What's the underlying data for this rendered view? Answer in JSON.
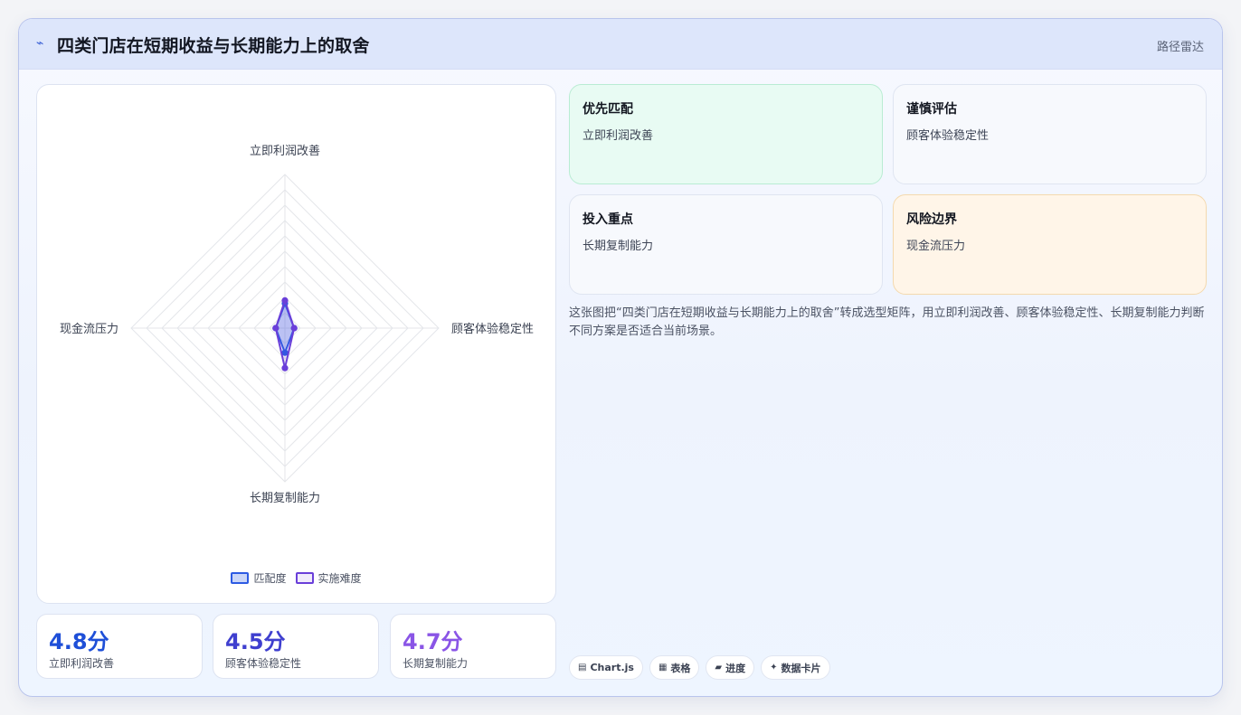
{
  "header": {
    "icon": "sparkline-icon",
    "title": "四类门店在短期收益与长期能力上的取舍",
    "tag": "路径雷达"
  },
  "chart_data": {
    "type": "radar",
    "axes": [
      "立即利润改善",
      "顾客体验稳定性",
      "长期复制能力",
      "现金流压力"
    ],
    "rmax": 5,
    "rings": 10,
    "series": [
      {
        "name": "匹配度",
        "values": [
          0.8,
          0.3,
          0.8,
          0.3
        ],
        "color": "#2d5be3"
      },
      {
        "name": "实施难度",
        "values": [
          0.9,
          0.3,
          1.3,
          0.3
        ],
        "color": "#6a3fd9"
      }
    ]
  },
  "stats": [
    {
      "value": "4.8分",
      "label": "立即利润改善",
      "color": "#1e4fd8"
    },
    {
      "value": "4.5分",
      "label": "顾客体验稳定性",
      "color": "#3f3fcf"
    },
    {
      "value": "4.7分",
      "label": "长期复制能力",
      "color": "#8a55e6"
    }
  ],
  "boxes": [
    {
      "title": "优先匹配",
      "sub": "立即利润改善"
    },
    {
      "title": "谨慎评估",
      "sub": "顾客体验稳定性"
    },
    {
      "title": "投入重点",
      "sub": "长期复制能力"
    },
    {
      "title": "风险边界",
      "sub": "现金流压力"
    }
  ],
  "description": "这张图把“四类门店在短期收益与长期能力上的取舍”转成选型矩阵，用立即利润改善、顾客体验稳定性、长期复制能力判断不同方案是否适合当前场景。",
  "chips": [
    {
      "icon": "▤",
      "label": "Chart.js"
    },
    {
      "icon": "▦",
      "label": "表格"
    },
    {
      "icon": "▰",
      "label": "进度"
    },
    {
      "icon": "✦",
      "label": "数据卡片"
    }
  ]
}
